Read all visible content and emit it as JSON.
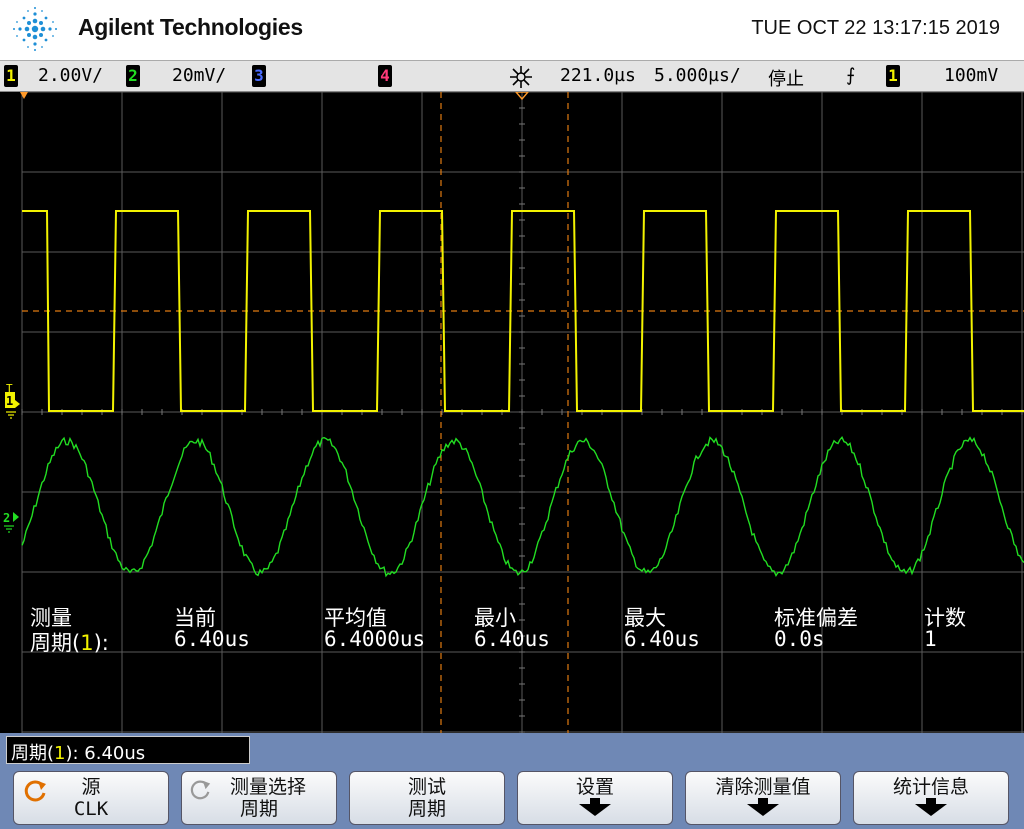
{
  "header": {
    "brand": "Agilent Technologies",
    "datetime": "TUE OCT 22 13:17:15 2019"
  },
  "status": {
    "ch1": {
      "num": "1",
      "scale": "2.00V/",
      "color": "#f2f200"
    },
    "ch2": {
      "num": "2",
      "scale": "20mV/",
      "color": "#22dd22"
    },
    "ch3": {
      "num": "3",
      "color": "#4a6cff"
    },
    "ch4": {
      "num": "4",
      "color": "#ff3a7a"
    },
    "delay": "221.0µs",
    "timebase": "5.000µs/",
    "run_state": "停止",
    "trigger_slope": "⨍",
    "trigger_source": "1",
    "trigger_level": "100mV"
  },
  "markers": {
    "ch1_marker": "1",
    "ch2_marker": "2",
    "trigger_marker": "T"
  },
  "measurement": {
    "headers": [
      "测量",
      "当前",
      "平均值",
      "最小",
      "最大",
      "标准偏差",
      "计数"
    ],
    "row_label_prefix": "周期(",
    "row_label_channel": "1",
    "row_label_suffix": "):",
    "values": [
      "6.40us",
      "6.4000us",
      "6.40us",
      "6.40us",
      "0.0s",
      "1"
    ]
  },
  "readout": {
    "label_prefix": "周期(",
    "label_channel": "1",
    "label_suffix": "): 6.40us"
  },
  "softkeys": [
    {
      "line1": "源",
      "line2": "CLK",
      "icon": "rotate-knob-icon"
    },
    {
      "line1": "测量选择",
      "line2": "周期",
      "icon": "rotate-knob-icon"
    },
    {
      "line1": "测试",
      "line2": "周期"
    },
    {
      "line1": "设置",
      "arrow": true
    },
    {
      "line1": "清除测量值",
      "arrow": true
    },
    {
      "line1": "统计信息",
      "arrow": true
    }
  ]
}
